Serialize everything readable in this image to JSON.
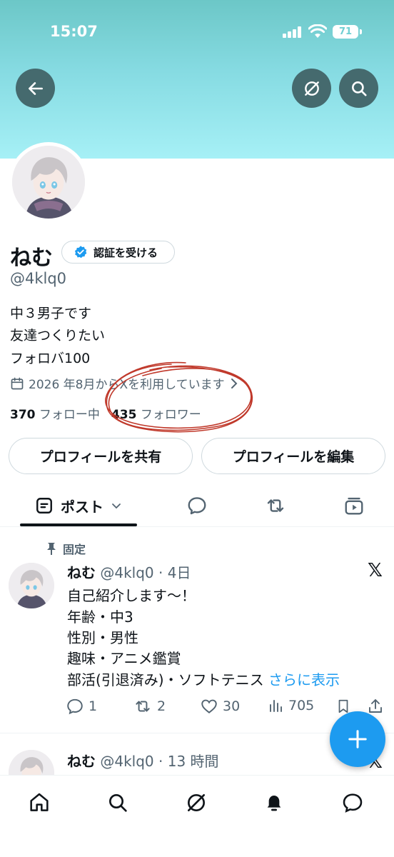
{
  "status_bar": {
    "time": "15:07",
    "battery": "71"
  },
  "profile": {
    "name": "ねむ",
    "verify_label": "認証を受ける",
    "handle": "@4klq0",
    "bio": [
      "中３男子です",
      "友達つくりたい",
      "フォロバ100"
    ],
    "joined": "2026 年8月からXを利用しています",
    "following_count": "370",
    "following_label": "フォロー中",
    "followers_count": "435",
    "followers_label": "フォロワー"
  },
  "buttons": {
    "share": "プロフィールを共有",
    "edit": "プロフィールを編集"
  },
  "tabs": {
    "posts_label": "ポスト"
  },
  "posts": [
    {
      "pinned_label": "固定",
      "name": "ねむ",
      "meta": "@4klq0 · 4日",
      "lines": [
        "自己紹介します〜！",
        "年齢・中3",
        "性別・男性",
        "趣味・アニメ鑑賞",
        "部活(引退済み)・ソフトテニス"
      ],
      "more_label": "さらに表示",
      "replies": "1",
      "reposts": "2",
      "likes": "30",
      "views": "705"
    },
    {
      "name": "ねむ",
      "meta": "@4klq0 · 13 時間"
    }
  ],
  "colors": {
    "accent": "#1d9bf0",
    "banner": "#86dbe2",
    "annotation": "#c0392b"
  }
}
